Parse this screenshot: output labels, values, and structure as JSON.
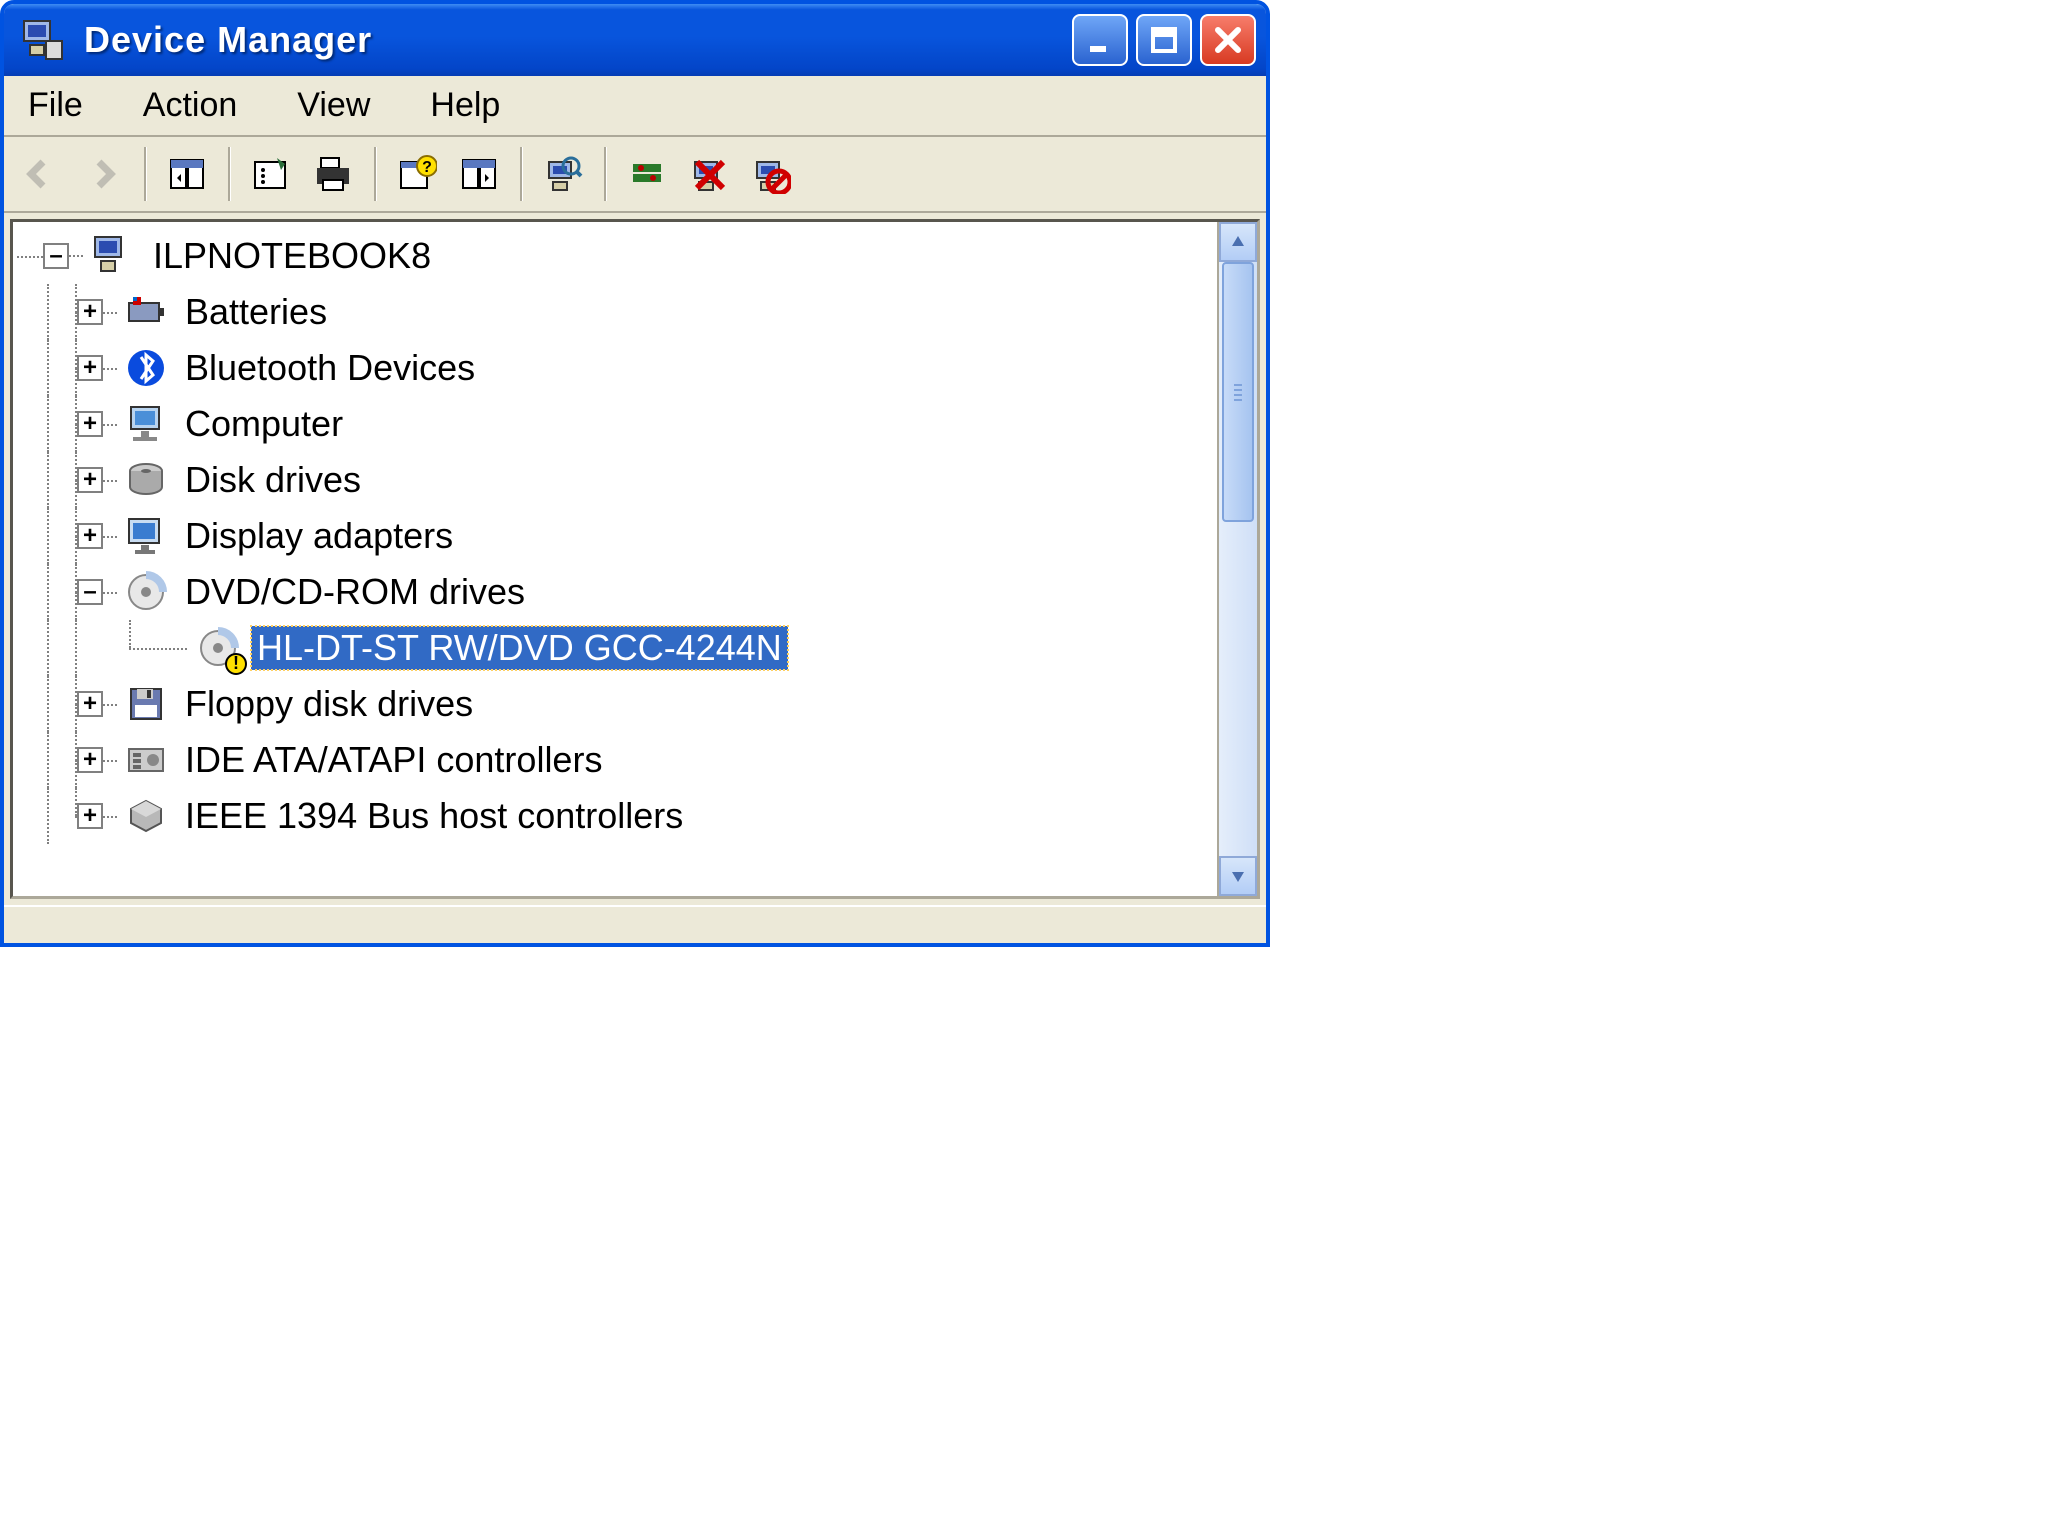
{
  "window": {
    "title": "Device Manager"
  },
  "menu": {
    "file": "File",
    "action": "Action",
    "view": "View",
    "help": "Help"
  },
  "toolbar": {
    "back": "Back",
    "forward": "Forward",
    "show_hide": "Show/Hide Console Tree",
    "properties": "Properties",
    "print": "Print",
    "help": "Help",
    "action_pane": "Action Pane",
    "scan": "Scan for hardware changes",
    "update": "Update Driver",
    "uninstall": "Uninstall",
    "disable": "Disable"
  },
  "tree": {
    "root": "ILPNOTEBOOK8",
    "items": [
      {
        "label": "Batteries",
        "icon": "battery"
      },
      {
        "label": "Bluetooth Devices",
        "icon": "bluetooth"
      },
      {
        "label": "Computer",
        "icon": "computer"
      },
      {
        "label": "Disk drives",
        "icon": "disk"
      },
      {
        "label": "Display adapters",
        "icon": "display"
      },
      {
        "label": "DVD/CD-ROM drives",
        "icon": "cdrom",
        "expanded": true,
        "children": [
          {
            "label": "HL-DT-ST RW/DVD GCC-4244N",
            "icon": "cdrom",
            "selected": true,
            "warning": true
          }
        ]
      },
      {
        "label": "Floppy disk drives",
        "icon": "floppy"
      },
      {
        "label": "IDE ATA/ATAPI controllers",
        "icon": "ide"
      },
      {
        "label": "IEEE 1394 Bus host controllers",
        "icon": "chip"
      }
    ]
  }
}
